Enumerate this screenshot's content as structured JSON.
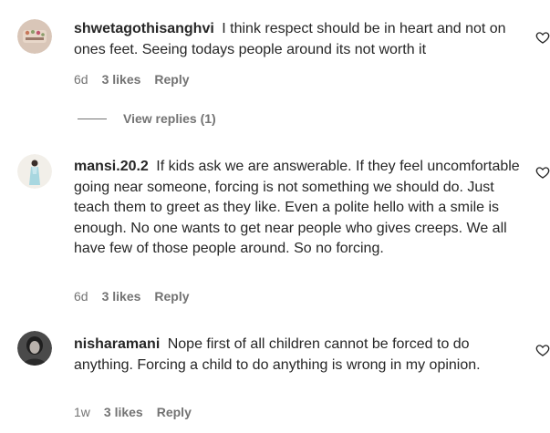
{
  "comments": [
    {
      "username": "shwetagothisanghvi",
      "text": "I think respect should be in heart and not on ones feet. Seeing todays people around its not worth it",
      "time": "6d",
      "likes": "3 likes",
      "reply": "Reply",
      "view_replies": "View replies (1)"
    },
    {
      "username": "mansi.20.2",
      "text": "If kids ask we are answerable. If they feel uncomfortable going near someone, forcing is not something we should do. Just teach them to greet as they like. Even a polite hello with a smile is enough. No one wants to get near people who gives creeps. We all have few of those people around. So no forcing.",
      "time": "6d",
      "likes": "3 likes",
      "reply": "Reply"
    },
    {
      "username": "nisharamani",
      "text": "Nope first of all children cannot be forced to do anything. Forcing a child to do anything is wrong in my opinion.",
      "time": "1w",
      "likes": "3 likes",
      "reply": "Reply"
    }
  ],
  "icons": {
    "like": "heart-outline-icon"
  },
  "colors": {
    "text": "#262626",
    "secondary": "#737373"
  }
}
